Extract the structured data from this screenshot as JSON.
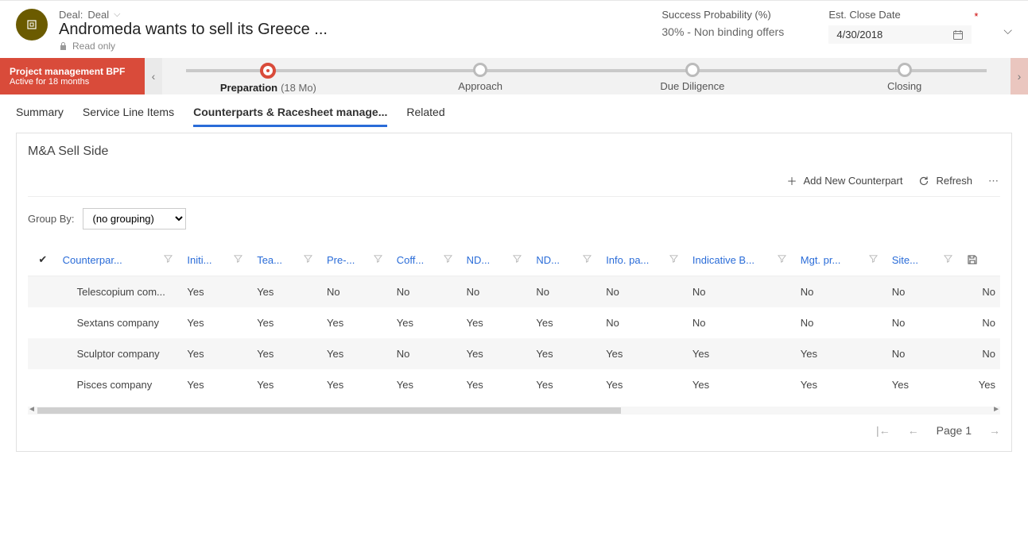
{
  "header": {
    "breadcrumb_label": "Deal:",
    "breadcrumb_value": "Deal",
    "title": "Andromeda wants to sell its Greece ...",
    "readonly_label": "Read only",
    "fields": {
      "success_prob_label": "Success Probability (%)",
      "success_prob_value": "30% - Non binding offers",
      "close_date_label": "Est. Close Date",
      "close_date_value": "4/30/2018"
    }
  },
  "process": {
    "flag_title": "Project management BPF",
    "flag_sub": "Active for 18 months",
    "stages": [
      {
        "label": "Preparation",
        "sub": "(18 Mo)",
        "current": true
      },
      {
        "label": "Approach",
        "sub": "",
        "current": false
      },
      {
        "label": "Due Diligence",
        "sub": "",
        "current": false
      },
      {
        "label": "Closing",
        "sub": "",
        "current": false
      }
    ]
  },
  "tabs": [
    {
      "label": "Summary",
      "active": false
    },
    {
      "label": "Service Line Items",
      "active": false
    },
    {
      "label": "Counterparts & Racesheet manage...",
      "active": true
    },
    {
      "label": "Related",
      "active": false
    }
  ],
  "panel": {
    "title": "M&A Sell Side",
    "add_label": "Add New Counterpart",
    "refresh_label": "Refresh",
    "groupby_label": "Group By:",
    "groupby_value": "(no grouping)",
    "pager_text": "Page 1"
  },
  "grid": {
    "columns": [
      "Counterpar...",
      "Initi...",
      "Tea...",
      "Pre-...",
      "Coff...",
      "ND...",
      "ND...",
      "Info. pa...",
      "Indicative B...",
      "Mgt. pr...",
      "Site..."
    ],
    "rows": [
      {
        "name": "Telescopium com...",
        "vals": [
          "Yes",
          "Yes",
          "No",
          "No",
          "No",
          "No",
          "No",
          "No",
          "No",
          "No",
          "No"
        ]
      },
      {
        "name": "Sextans company",
        "vals": [
          "Yes",
          "Yes",
          "Yes",
          "Yes",
          "Yes",
          "Yes",
          "No",
          "No",
          "No",
          "No",
          "No"
        ]
      },
      {
        "name": "Sculptor company",
        "vals": [
          "Yes",
          "Yes",
          "Yes",
          "No",
          "Yes",
          "Yes",
          "Yes",
          "Yes",
          "Yes",
          "No",
          "No"
        ]
      },
      {
        "name": "Pisces company",
        "vals": [
          "Yes",
          "Yes",
          "Yes",
          "Yes",
          "Yes",
          "Yes",
          "Yes",
          "Yes",
          "Yes",
          "Yes",
          "Yes"
        ]
      }
    ]
  }
}
